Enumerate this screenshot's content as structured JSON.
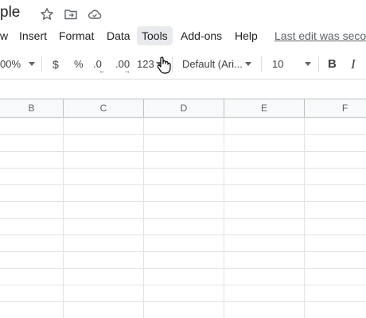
{
  "title_bar": {
    "doc_title": "ple",
    "icons": [
      "star-icon",
      "move-to-folder-icon",
      "cloud-status-icon"
    ]
  },
  "menu": {
    "items": [
      {
        "label": "w"
      },
      {
        "label": "Insert"
      },
      {
        "label": "Format"
      },
      {
        "label": "Data"
      },
      {
        "label": "Tools",
        "active": true
      },
      {
        "label": "Add-ons"
      },
      {
        "label": "Help"
      }
    ],
    "last_edit": "Last edit was seco"
  },
  "toolbar": {
    "zoom": "00%",
    "currency": "$",
    "percent": "%",
    "decrease_decimal": ".0",
    "increase_decimal": ".00",
    "more_formats": "123",
    "font": "Default (Ari...",
    "font_size": "10",
    "bold": "B",
    "italic": "I"
  },
  "grid": {
    "columns": [
      "B",
      "C",
      "D",
      "E",
      "F"
    ]
  },
  "colors": {
    "menu_active_bg": "#e8eaed",
    "grid_line": "#e2e3e3",
    "header_bg": "#f8f9fa",
    "link_gray": "#5f6368"
  }
}
